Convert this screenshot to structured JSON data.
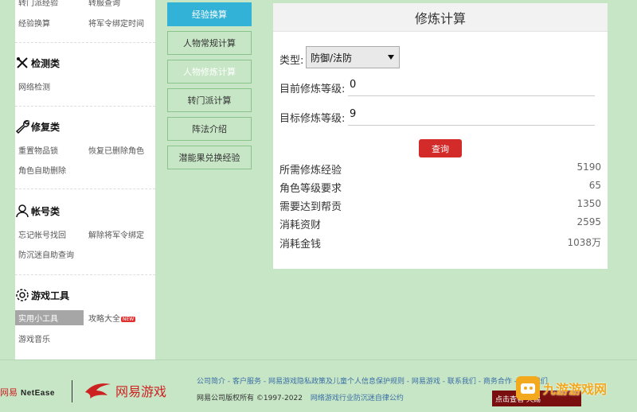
{
  "sidebar": {
    "top_links": [
      "转门派经验",
      "转服查询",
      "经验换算",
      "将军令绑定时间"
    ],
    "sections": [
      {
        "title": "检测类",
        "icon": "tools-icon",
        "links": [
          "网络检测"
        ]
      },
      {
        "title": "修复类",
        "icon": "wrench-icon",
        "links": [
          "重置物品锁",
          "恢复已删除角色",
          "角色自助删除"
        ]
      },
      {
        "title": "帐号类",
        "icon": "user-icon",
        "links": [
          "忘记帐号找回",
          "解除将军令绑定",
          "防沉迷自助查询"
        ]
      },
      {
        "title": "游戏工具",
        "icon": "gear-icon",
        "links": [
          "实用小工具",
          "攻略大全",
          "游戏音乐"
        ],
        "badge": "NEW"
      }
    ]
  },
  "tabs": [
    "经验换算",
    "人物常规计算",
    "人物修炼计算",
    "转门派计算",
    "阵法介绍",
    "潜能果兑换经验"
  ],
  "panel": {
    "title": "修炼计算",
    "type_label": "类型:",
    "type_value": "防御/法防",
    "current_label": "目前修炼等级:",
    "current_value": "0",
    "target_label": "目标修炼等级:",
    "target_value": "9",
    "query_label": "查询",
    "results": [
      {
        "label": "所需修炼经验",
        "value": "5190"
      },
      {
        "label": "角色等级要求",
        "value": "65"
      },
      {
        "label": "需要达到帮贡",
        "value": "1350"
      },
      {
        "label": "消耗资财",
        "value": "2595"
      },
      {
        "label": "消耗金钱",
        "value": "1038万"
      }
    ]
  },
  "footer": {
    "logo_cn": "网易",
    "logo_en": "NetEase",
    "logo_games": "网易游戏",
    "links": "公司简介 - 客户服务 - 网易游戏隐私政策及儿童个人信息保护规则 - 网易游戏 - 联系我们 - 商务合作 - 加入我们",
    "copyright": "网易公司版权所有 ©1997-2022",
    "copyright_link": "网络游戏行业防沉迷自律公约",
    "ext_button": "点击查看    天赐",
    "watermark": "九游游戏网"
  }
}
